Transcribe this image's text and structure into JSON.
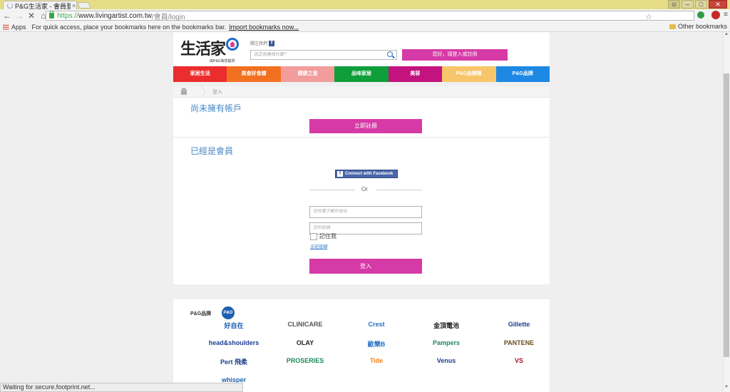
{
  "browser": {
    "tab_title": "P&G生活家 - 會員登",
    "tab_close": "×",
    "url_scheme": "https://",
    "url_host": "www.livingartist.com.tw",
    "url_path": "/會員/login",
    "apps_label": "Apps",
    "bookmarks_hint": "For quick access, place your bookmarks here on the bookmarks bar.",
    "import_bookmarks": "Import bookmarks now...",
    "other_bookmarks": "Other bookmarks",
    "status_text": "Waiting for secure.footprint.net...",
    "accent_colors": {
      "titlebar": "#e6dc86",
      "secure_green": "#3aa548"
    }
  },
  "header": {
    "logo_text": "生活家",
    "logo_sub": "由P&G為您提供",
    "follow_label": "關注我們",
    "search_placeholder": "您正在尋找什麼？",
    "login_button": "您好，請登入或註冊"
  },
  "categories": [
    {
      "label": "家居生活",
      "color": "#ec2d2d"
    },
    {
      "label": "美食好食譜",
      "color": "#f37021"
    },
    {
      "label": "健康之道",
      "color": "#f29c9c"
    },
    {
      "label": "品味家居",
      "color": "#0e9e3a"
    },
    {
      "label": "美容",
      "color": "#c4127e"
    },
    {
      "label": "P&G品牌館",
      "color": "#f8c66a"
    },
    {
      "label": "P&G品牌",
      "color": "#1e88e5"
    }
  ],
  "breadcrumb": {
    "current": "登入"
  },
  "register": {
    "title": "尚未擁有帳戶",
    "button": "立即註冊"
  },
  "login": {
    "title": "已經是會員",
    "facebook_button": "Connect with Facebook",
    "or_text": "Or",
    "email_placeholder": "您的電子郵件地址",
    "password_placeholder": "您的密碼",
    "remember_label": "記住我",
    "forgot_link": "忘記密碼",
    "submit_button": "登入"
  },
  "brands": {
    "title": "P&G品牌",
    "badge": "P&G",
    "items": [
      {
        "name": "好自在",
        "color": "#1b5fb0"
      },
      {
        "name": "CLINICARE",
        "color": "#555555"
      },
      {
        "name": "Crest",
        "color": "#1e6fc4"
      },
      {
        "name": "金頂電池",
        "color": "#222222"
      },
      {
        "name": "Gillette",
        "color": "#1b3f8f"
      },
      {
        "name": "head&shoulders",
        "color": "#1b3f8f"
      },
      {
        "name": "OLAY",
        "color": "#222222"
      },
      {
        "name": "歐樂B",
        "color": "#1e6fc4"
      },
      {
        "name": "Pampers",
        "color": "#1d8a5a"
      },
      {
        "name": "PANTENE",
        "color": "#6b4b1f"
      },
      {
        "name": "Pert 飛柔",
        "color": "#1b3f8f"
      },
      {
        "name": "PROSERIES",
        "color": "#1d8a5a"
      },
      {
        "name": "Tide",
        "color": "#f58220"
      },
      {
        "name": "Venus",
        "color": "#1b3f8f"
      },
      {
        "name": "VS",
        "color": "#a8162e"
      },
      {
        "name": "whisper",
        "color": "#1b5fb0"
      }
    ]
  }
}
